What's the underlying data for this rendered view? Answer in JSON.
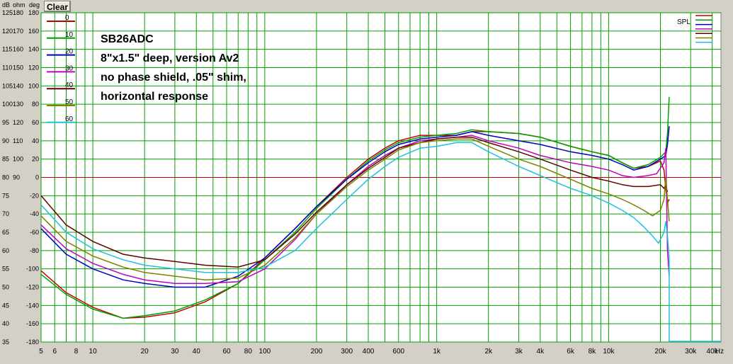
{
  "toolbar": {
    "clear_label": "Clear"
  },
  "axis_units": {
    "db": "dB",
    "ohm": "ohm",
    "deg": "deg"
  },
  "notes": [
    "SB26ADC",
    "8\"x1.5\" deep, version Av2",
    "no phase shield, .05\" shim,",
    "horizontal response"
  ],
  "colors": {
    "plot_bg": "#ffffff",
    "grid": "#00a000",
    "reference_line": "#c00000",
    "window_bg": "#d4d0c8"
  },
  "chart_data": {
    "type": "line",
    "x_scale": "log",
    "xlim": [
      5,
      45000
    ],
    "ylim_db": [
      35,
      125
    ],
    "y_ticks": {
      "db": [
        125,
        120,
        115,
        110,
        105,
        100,
        95,
        90,
        85,
        80,
        75,
        70,
        65,
        60,
        55,
        50,
        45,
        40,
        35
      ],
      "ohm": [
        180,
        170,
        160,
        150,
        140,
        130,
        120,
        110,
        100,
        90,
        "",
        "",
        "",
        "",
        "",
        "",
        "",
        "",
        ""
      ],
      "deg": [
        180,
        160,
        140,
        120,
        100,
        80,
        60,
        40,
        20,
        0,
        -20,
        -40,
        -60,
        -80,
        -100,
        -120,
        -140,
        -160,
        -180
      ]
    },
    "x_tick_labels": [
      {
        "x": 5,
        "label": "5"
      },
      {
        "x": 6,
        "label": "6"
      },
      {
        "x": 8,
        "label": "8"
      },
      {
        "x": 10,
        "label": "10"
      },
      {
        "x": 20,
        "label": "20"
      },
      {
        "x": 30,
        "label": "30"
      },
      {
        "x": 40,
        "label": "40"
      },
      {
        "x": 60,
        "label": "60"
      },
      {
        "x": 80,
        "label": "80"
      },
      {
        "x": 100,
        "label": "100"
      },
      {
        "x": 200,
        "label": "200"
      },
      {
        "x": 300,
        "label": "300"
      },
      {
        "x": 400,
        "label": "400"
      },
      {
        "x": 600,
        "label": "600"
      },
      {
        "x": 1000,
        "label": "1k"
      },
      {
        "x": 2000,
        "label": "2k"
      },
      {
        "x": 3000,
        "label": "3k"
      },
      {
        "x": 4000,
        "label": "4k"
      },
      {
        "x": 6000,
        "label": "6k"
      },
      {
        "x": 8000,
        "label": "8k"
      },
      {
        "x": 10000,
        "label": "10k"
      },
      {
        "x": 20000,
        "label": "20k"
      },
      {
        "x": 30000,
        "label": "30k"
      },
      {
        "x": 40000,
        "label": "40k"
      }
    ],
    "x_unit_label": "Hz",
    "reference_line_db": 80,
    "legend_right_label": "SPL",
    "grid": true,
    "series": [
      {
        "name": "0",
        "color": "#c00000",
        "points": [
          [
            5,
            54.5
          ],
          [
            7,
            48.5
          ],
          [
            10,
            44.5
          ],
          [
            15,
            41.5
          ],
          [
            20,
            41.8
          ],
          [
            30,
            43
          ],
          [
            45,
            46
          ],
          [
            70,
            51
          ],
          [
            100,
            58
          ],
          [
            150,
            66
          ],
          [
            200,
            72
          ],
          [
            300,
            80
          ],
          [
            400,
            85
          ],
          [
            500,
            88
          ],
          [
            600,
            90
          ],
          [
            800,
            91.5
          ],
          [
            1000,
            91.5
          ],
          [
            1300,
            91.5
          ],
          [
            1600,
            92.5
          ],
          [
            2000,
            92.5
          ],
          [
            3000,
            92
          ],
          [
            4000,
            91
          ],
          [
            6000,
            88.5
          ],
          [
            8000,
            87
          ],
          [
            10000,
            86
          ],
          [
            12000,
            84
          ],
          [
            14000,
            82.5
          ],
          [
            17000,
            83
          ],
          [
            20000,
            84.5
          ],
          [
            21000,
            82
          ],
          [
            21500,
            77
          ],
          [
            22000,
            73
          ],
          [
            22500,
            74
          ]
        ]
      },
      {
        "name": "10",
        "color": "#00a000",
        "points": [
          [
            5,
            53.5
          ],
          [
            7,
            48
          ],
          [
            10,
            44
          ],
          [
            15,
            41.5
          ],
          [
            20,
            42.2
          ],
          [
            30,
            43.5
          ],
          [
            45,
            46.5
          ],
          [
            70,
            51
          ],
          [
            100,
            57.5
          ],
          [
            150,
            65
          ],
          [
            200,
            71.5
          ],
          [
            300,
            79.5
          ],
          [
            400,
            84.5
          ],
          [
            500,
            87.5
          ],
          [
            600,
            89.5
          ],
          [
            800,
            91
          ],
          [
            1000,
            91.5
          ],
          [
            1300,
            92
          ],
          [
            1600,
            93
          ],
          [
            2000,
            92.5
          ],
          [
            3000,
            92
          ],
          [
            4000,
            91
          ],
          [
            6000,
            88.5
          ],
          [
            8000,
            87
          ],
          [
            10000,
            86
          ],
          [
            12000,
            84
          ],
          [
            14000,
            82.5
          ],
          [
            17000,
            83.5
          ],
          [
            20000,
            85.5
          ],
          [
            21500,
            87
          ],
          [
            22000,
            92
          ],
          [
            22500,
            102
          ]
        ]
      },
      {
        "name": "20",
        "color": "#0000c0",
        "points": [
          [
            5,
            66
          ],
          [
            7,
            59
          ],
          [
            10,
            55
          ],
          [
            15,
            52
          ],
          [
            20,
            51
          ],
          [
            30,
            50
          ],
          [
            45,
            50
          ],
          [
            70,
            53
          ],
          [
            100,
            58
          ],
          [
            150,
            66
          ],
          [
            200,
            72
          ],
          [
            300,
            79.5
          ],
          [
            400,
            84
          ],
          [
            500,
            87
          ],
          [
            600,
            89
          ],
          [
            800,
            90.5
          ],
          [
            1000,
            91
          ],
          [
            1300,
            91.5
          ],
          [
            1600,
            92.5
          ],
          [
            2000,
            91.5
          ],
          [
            3000,
            90
          ],
          [
            4000,
            89
          ],
          [
            6000,
            87
          ],
          [
            8000,
            86
          ],
          [
            10000,
            85
          ],
          [
            12000,
            83.5
          ],
          [
            14000,
            82
          ],
          [
            17000,
            83
          ],
          [
            20000,
            85
          ],
          [
            21500,
            86
          ],
          [
            22000,
            89
          ],
          [
            22500,
            94
          ]
        ]
      },
      {
        "name": "30",
        "color": "#c000c0",
        "points": [
          [
            5,
            67
          ],
          [
            7,
            60.5
          ],
          [
            10,
            56.5
          ],
          [
            15,
            53.5
          ],
          [
            20,
            52
          ],
          [
            30,
            51
          ],
          [
            45,
            51
          ],
          [
            70,
            51.5
          ],
          [
            100,
            55
          ],
          [
            150,
            63
          ],
          [
            200,
            70
          ],
          [
            300,
            78
          ],
          [
            400,
            83
          ],
          [
            500,
            86
          ],
          [
            600,
            88
          ],
          [
            800,
            90
          ],
          [
            1000,
            90.5
          ],
          [
            1300,
            91
          ],
          [
            1600,
            91.5
          ],
          [
            2000,
            90
          ],
          [
            3000,
            88
          ],
          [
            4000,
            86
          ],
          [
            6000,
            84
          ],
          [
            8000,
            83
          ],
          [
            10000,
            82
          ],
          [
            12000,
            80.5
          ],
          [
            14000,
            80
          ],
          [
            17000,
            80.5
          ],
          [
            19000,
            81
          ],
          [
            21000,
            84
          ],
          [
            21500,
            88
          ],
          [
            22000,
            60
          ],
          [
            22500,
            53
          ]
        ]
      },
      {
        "name": "40",
        "color": "#600000",
        "points": [
          [
            5,
            75
          ],
          [
            7,
            67
          ],
          [
            10,
            62.5
          ],
          [
            15,
            59
          ],
          [
            20,
            58
          ],
          [
            30,
            57
          ],
          [
            45,
            56
          ],
          [
            70,
            55.5
          ],
          [
            100,
            57.5
          ],
          [
            150,
            64.5
          ],
          [
            200,
            70.5
          ],
          [
            300,
            78
          ],
          [
            400,
            82.5
          ],
          [
            500,
            85.5
          ],
          [
            600,
            88
          ],
          [
            800,
            89.5
          ],
          [
            1000,
            90.5
          ],
          [
            1300,
            91
          ],
          [
            1600,
            91
          ],
          [
            2000,
            89.5
          ],
          [
            3000,
            87
          ],
          [
            4000,
            85
          ],
          [
            6000,
            82
          ],
          [
            8000,
            80
          ],
          [
            10000,
            79
          ],
          [
            12000,
            78
          ],
          [
            14000,
            77.5
          ],
          [
            17000,
            77.5
          ],
          [
            20000,
            78
          ],
          [
            21000,
            77
          ],
          [
            21500,
            78
          ],
          [
            22000,
            76
          ]
        ]
      },
      {
        "name": "50",
        "color": "#808000",
        "points": [
          [
            5,
            69.5
          ],
          [
            7,
            62.5
          ],
          [
            10,
            58.5
          ],
          [
            15,
            55.5
          ],
          [
            20,
            54
          ],
          [
            30,
            53
          ],
          [
            45,
            52
          ],
          [
            70,
            52.5
          ],
          [
            100,
            56
          ],
          [
            150,
            63.5
          ],
          [
            200,
            70
          ],
          [
            300,
            77.5
          ],
          [
            400,
            82
          ],
          [
            500,
            85
          ],
          [
            600,
            87.5
          ],
          [
            800,
            89.5
          ],
          [
            1000,
            90
          ],
          [
            1300,
            90.5
          ],
          [
            1600,
            90.5
          ],
          [
            2000,
            88.5
          ],
          [
            3000,
            85
          ],
          [
            4000,
            83
          ],
          [
            6000,
            79.5
          ],
          [
            8000,
            77
          ],
          [
            10000,
            75.5
          ],
          [
            12000,
            74
          ],
          [
            14000,
            72.5
          ],
          [
            16000,
            71
          ],
          [
            18000,
            69.5
          ],
          [
            20000,
            71
          ],
          [
            21000,
            74
          ],
          [
            21500,
            80
          ],
          [
            22000,
            74
          ],
          [
            22500,
            68
          ]
        ]
      },
      {
        "name": "60",
        "color": "#20c0e0",
        "points": [
          [
            5,
            72.5
          ],
          [
            7,
            65
          ],
          [
            10,
            60.5
          ],
          [
            15,
            57.5
          ],
          [
            20,
            56
          ],
          [
            30,
            55
          ],
          [
            45,
            54
          ],
          [
            70,
            54
          ],
          [
            100,
            55.5
          ],
          [
            150,
            60
          ],
          [
            200,
            66
          ],
          [
            300,
            74
          ],
          [
            400,
            79.5
          ],
          [
            500,
            83
          ],
          [
            600,
            85.5
          ],
          [
            800,
            88
          ],
          [
            1000,
            88.5
          ],
          [
            1300,
            89.5
          ],
          [
            1600,
            89.5
          ],
          [
            2000,
            87
          ],
          [
            3000,
            83
          ],
          [
            4000,
            80.5
          ],
          [
            6000,
            77
          ],
          [
            8000,
            75
          ],
          [
            10000,
            73
          ],
          [
            12000,
            71
          ],
          [
            14000,
            69
          ],
          [
            16000,
            66.5
          ],
          [
            18000,
            64
          ],
          [
            19500,
            62
          ],
          [
            21000,
            65
          ],
          [
            21500,
            68
          ],
          [
            22000,
            64
          ],
          [
            22500,
            58
          ]
        ]
      }
    ]
  }
}
